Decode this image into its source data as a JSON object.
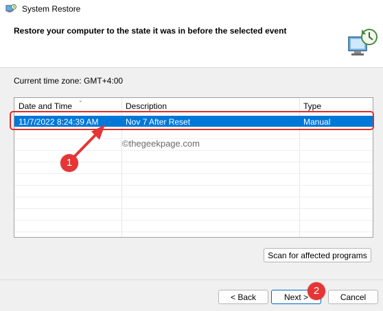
{
  "window": {
    "title": "System Restore"
  },
  "header": {
    "heading": "Restore your computer to the state it was in before the selected event"
  },
  "timezone_label": "Current time zone: GMT+4:00",
  "table": {
    "columns": [
      "Date and Time",
      "Description",
      "Type"
    ],
    "rows": [
      {
        "date": "11/7/2022 8:24:39 AM",
        "description": "Nov 7 After Reset",
        "type": "Manual",
        "selected": true
      }
    ]
  },
  "watermark": "©thegeekpage.com",
  "annotations": {
    "step1": "1",
    "step2": "2"
  },
  "buttons": {
    "scan": "Scan for affected programs",
    "back": "< Back",
    "next": "Next >",
    "cancel": "Cancel"
  },
  "colors": {
    "selection": "#0078d7",
    "annotation_red": "#e53535"
  }
}
